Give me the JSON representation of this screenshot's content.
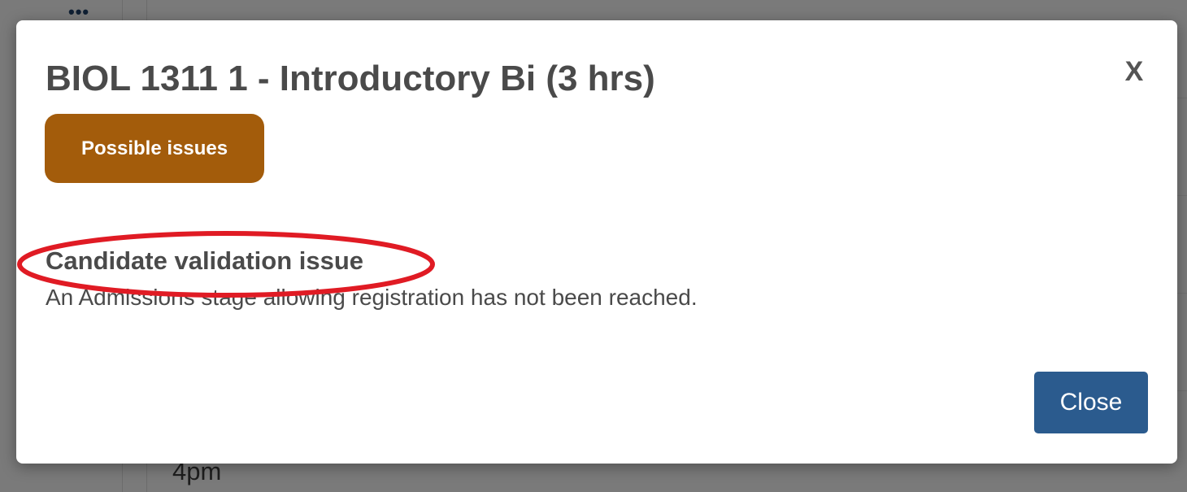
{
  "background": {
    "menu_icon": "dots-icon",
    "time_label": "4pm"
  },
  "modal": {
    "title": "BIOL 1311 1 - Introductory Bi (3 hrs)",
    "close_x_label": "X",
    "status_badge": "Possible issues",
    "issue": {
      "title": "Candidate validation issue",
      "description": "An Admissions stage allowing registration has not been reached."
    },
    "close_button_label": "Close"
  },
  "colors": {
    "badge_background": "#a35c0b",
    "close_button_background": "#2b5b8e",
    "highlight_annotation": "#e01b24",
    "text": "#4a4a4a"
  }
}
